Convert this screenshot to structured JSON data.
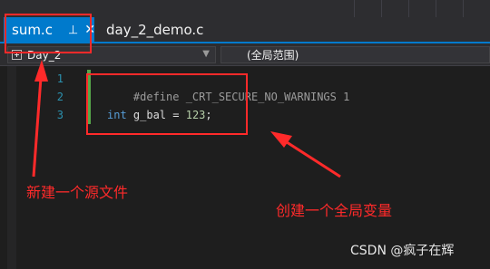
{
  "tabs": [
    {
      "label": "sum.c",
      "active": true
    },
    {
      "label": "day_2_demo.c",
      "active": false
    }
  ],
  "icons": {
    "pin": "pin-icon",
    "close": "close-icon",
    "project": "project-icon",
    "dropdown": "chevron-down-icon"
  },
  "navbar": {
    "project": "Day_2",
    "scope": "(全局范围)"
  },
  "editor": {
    "lines": [
      {
        "number": "1",
        "tokens": [
          {
            "text": "#define _CRT_SECURE_NO_WARNINGS 1",
            "kind": "preprocessor"
          }
        ]
      },
      {
        "number": "2",
        "tokens": []
      },
      {
        "number": "3",
        "tokens": [
          {
            "text": "int",
            "kind": "keyword"
          },
          {
            "text": " g_bal = ",
            "kind": "plain"
          },
          {
            "text": "123",
            "kind": "number"
          },
          {
            "text": ";",
            "kind": "plain"
          }
        ]
      }
    ]
  },
  "annotations": {
    "new_file": "新建一个源文件",
    "global_var": "创建一个全局变量"
  },
  "watermark": "CSDN @疯子在辉",
  "colors": {
    "accent": "#007acc",
    "annotation": "#ff2a2a",
    "keyword": "#569cd6",
    "line_number": "#2b91af"
  }
}
